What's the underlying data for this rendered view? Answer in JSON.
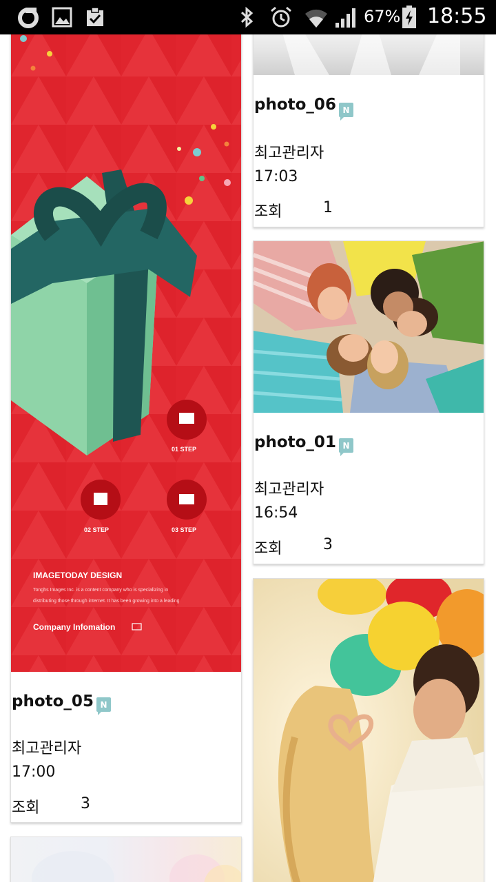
{
  "status_bar": {
    "battery_percent": "67%",
    "time": "18:55",
    "icons": [
      "o-app-icon",
      "gallery-icon",
      "clipboard-check-icon",
      "bluetooth-icon",
      "alarm-icon",
      "wifi-icon",
      "signal-icon",
      "battery-charging-icon"
    ]
  },
  "labels": {
    "views": "조회",
    "new_badge": "N"
  },
  "cards": [
    {
      "title": "photo_06",
      "author": "최고관리자",
      "time": "17:03",
      "views": "1",
      "image": "stage-light-image"
    },
    {
      "title": "photo_05",
      "author": "최고관리자",
      "time": "17:00",
      "views": "3",
      "image": "gift-box-poster-image",
      "poster": {
        "step1": "01 STEP",
        "step2": "02 STEP",
        "step3": "03 STEP",
        "heading": "IMAGETODAY DESIGN",
        "body1": "Tonghs Images Inc. is a content company who is specializing in",
        "body2": "distributing those through internet. It has been growing into a leading",
        "company": "Company Infomation"
      }
    },
    {
      "title": "photo_01",
      "author": "최고관리자",
      "time": "16:54",
      "views": "3",
      "image": "friends-shouting-image"
    },
    {
      "image": "couple-balloons-image"
    },
    {
      "image": "blurred-bokeh-image"
    }
  ],
  "colors": {
    "badge": "#8fc7c9",
    "poster_red": "#e0252e",
    "statusbar": "#000000"
  }
}
